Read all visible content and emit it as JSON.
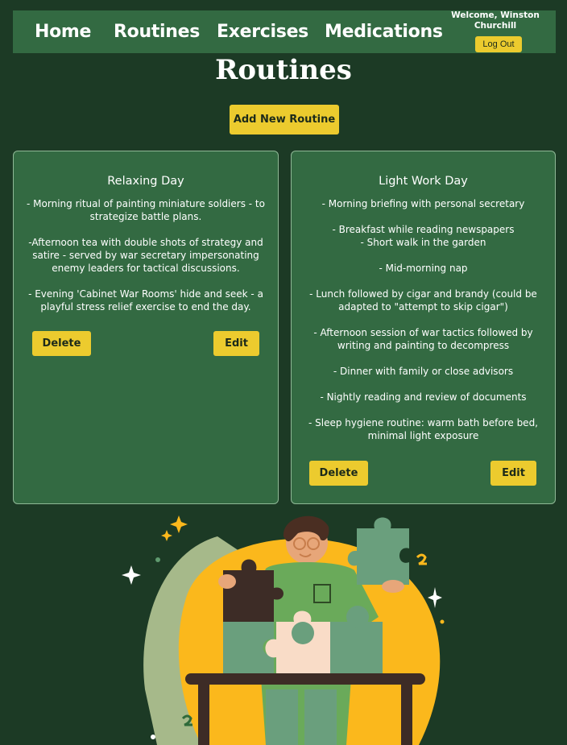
{
  "nav": {
    "links": [
      "Home",
      "Routines",
      "Exercises",
      "Medications"
    ],
    "welcome": "Welcome, Winston Churchill",
    "logout_label": "Log Out"
  },
  "page": {
    "title": "Routines",
    "add_label": "Add New Routine"
  },
  "routines": [
    {
      "title": "Relaxing Day",
      "body": "- Morning ritual of painting miniature soldiers - to strategize battle plans.\n\n-Afternoon tea with double shots of strategy and satire - served by war secretary impersonating enemy leaders for tactical discussions.\n\n- Evening 'Cabinet War Rooms' hide and seek - a playful stress relief exercise to end the day.",
      "delete_label": "Delete",
      "edit_label": "Edit"
    },
    {
      "title": "Light Work Day",
      "body": "- Morning briefing with personal secretary\n\n- Breakfast while reading newspapers\n- Short walk in the garden\n\n- Mid-morning nap\n\n- Lunch followed by cigar and brandy (could be adapted to \"attempt to skip cigar\")\n\n- Afternoon session of war tactics followed by writing and painting to decompress\n\n- Dinner with family or close advisors\n\n- Nightly reading and review of documents\n\n- Sleep hygiene routine: warm bath before bed, minimal light exposure",
      "delete_label": "Delete",
      "edit_label": "Edit"
    }
  ],
  "colors": {
    "background": "#1c3a25",
    "nav": "#336a42",
    "card": "#336a42",
    "accent": "#eccb2e"
  }
}
